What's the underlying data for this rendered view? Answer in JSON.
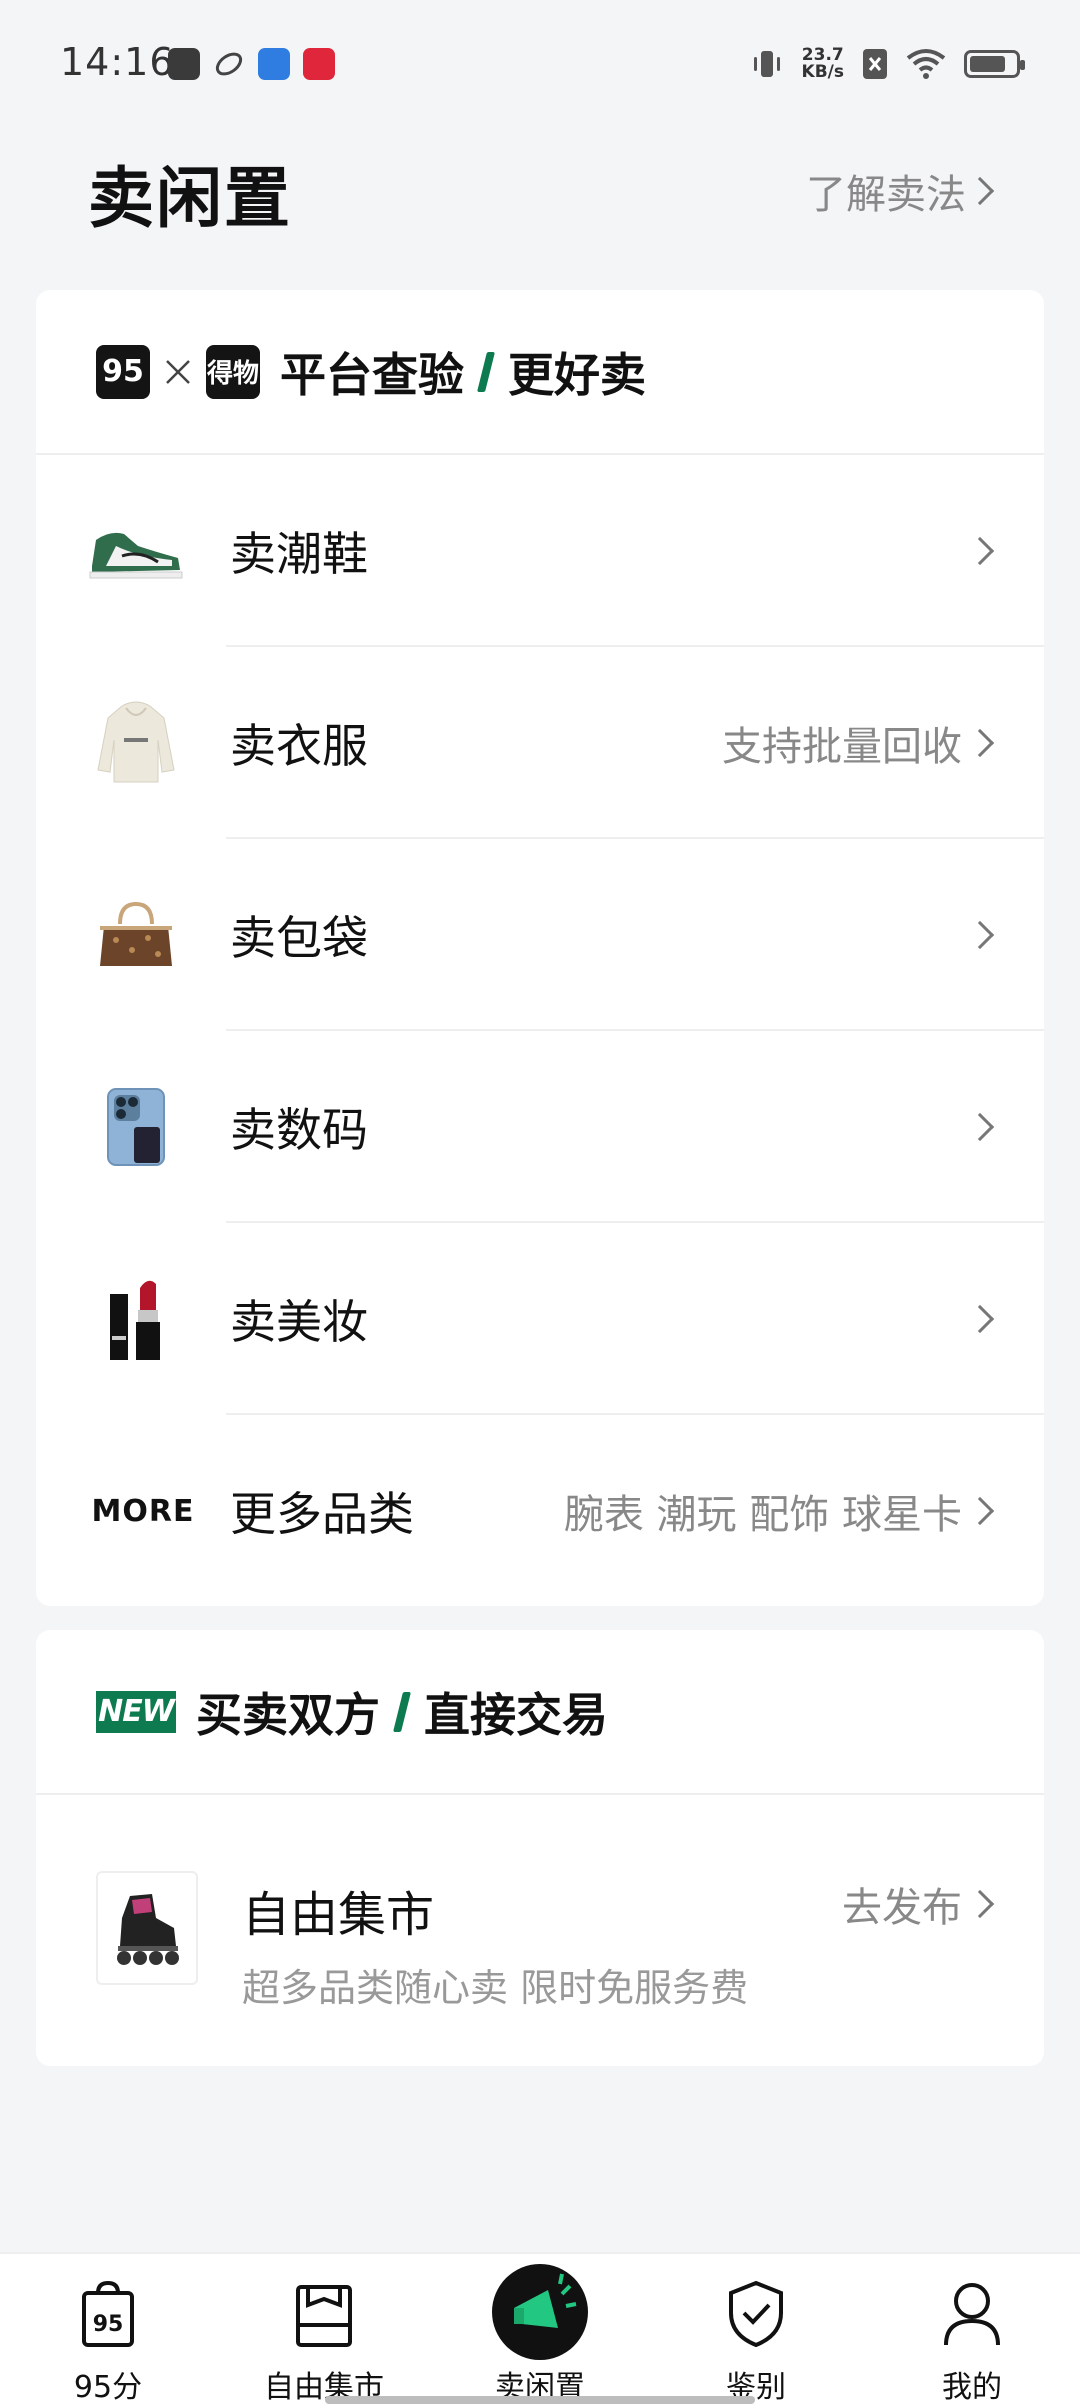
{
  "status_bar": {
    "time": "14:16",
    "net_speed_value": "23.7",
    "net_speed_unit": "KB/s"
  },
  "header": {
    "title": "卖闲置",
    "link_label": "了解卖法"
  },
  "platform_card": {
    "logo_95": "95",
    "logo_dewu": "得物",
    "heading_left": "平台查验",
    "heading_right": "更好卖",
    "items": [
      {
        "label": "卖潮鞋",
        "right_text": ""
      },
      {
        "label": "卖衣服",
        "right_text": "支持批量回收"
      },
      {
        "label": "卖包袋",
        "right_text": ""
      },
      {
        "label": "卖数码",
        "right_text": ""
      },
      {
        "label": "卖美妆",
        "right_text": ""
      }
    ],
    "more": {
      "badge": "MORE",
      "label": "更多品类",
      "right_text": "腕表 潮玩 配饰 球星卡"
    }
  },
  "direct_card": {
    "badge": "NEW",
    "heading_left": "买卖双方",
    "heading_right": "直接交易",
    "market": {
      "title": "自由集市",
      "subtitle": "超多品类随心卖 限时免服务费",
      "action": "去发布"
    }
  },
  "bottom_nav": {
    "tabs": [
      {
        "label": "95分"
      },
      {
        "label": "自由集市"
      },
      {
        "label": "卖闲置"
      },
      {
        "label": "鉴别"
      },
      {
        "label": "我的"
      }
    ]
  },
  "colors": {
    "accent_green": "#0d7a4f",
    "background": "#f4f5f7"
  }
}
